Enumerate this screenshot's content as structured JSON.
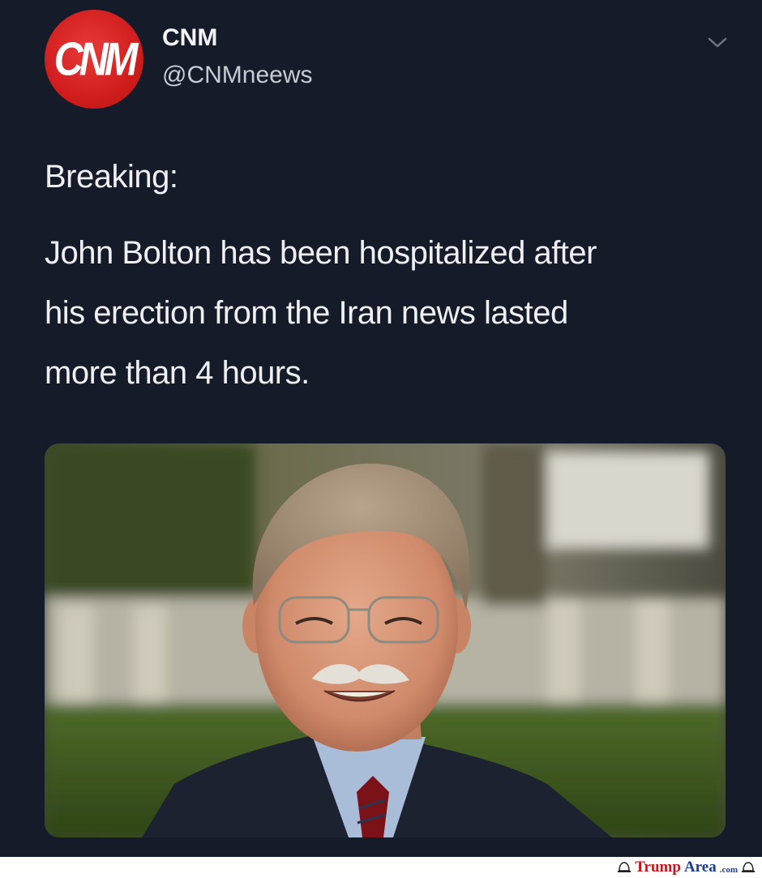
{
  "tweet": {
    "avatar_text": "CNM",
    "display_name": "CNM",
    "handle": "@CNMneews",
    "lines": [
      "Breaking:",
      "John Bolton has been hospitalized after",
      "his erection from the Iran news lasted",
      "more than 4 hours."
    ]
  },
  "watermark": {
    "part1": "Trump",
    "part2": "Area",
    "part3": ".com"
  },
  "icons": {
    "menu": "chevron-down-icon",
    "watermark": "hat-icon"
  },
  "colors": {
    "background": "#151b29",
    "avatar": "#d11d1d",
    "text": "#eef0f4",
    "watermark_red": "#c4161c",
    "watermark_blue": "#1b3d8f"
  }
}
